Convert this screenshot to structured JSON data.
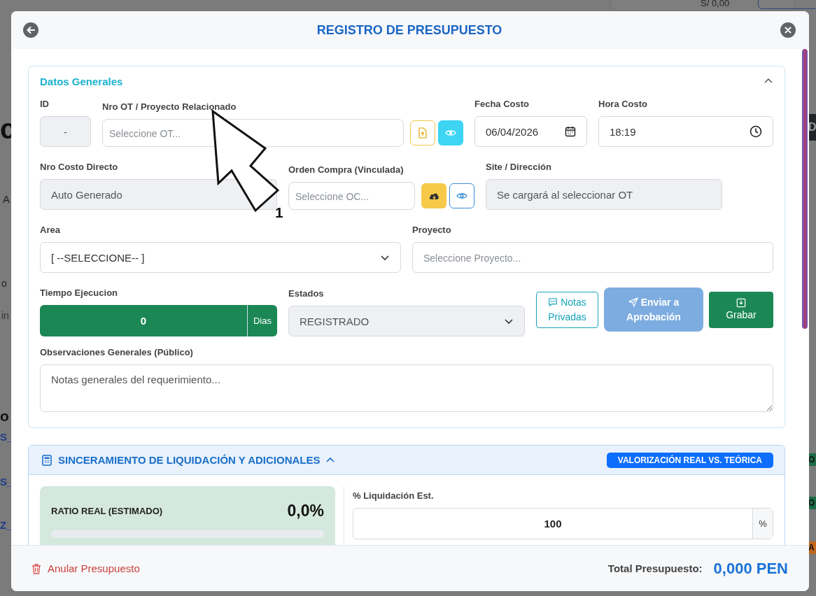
{
  "background_page": {
    "top_card_amount": "S/ 0,00",
    "title_fragment": "c",
    "tab_fragment": "A",
    "side_texts": [
      "o",
      "in"
    ],
    "section_fragment": "o",
    "link_fragments": [
      "S_",
      "S_",
      "Z_"
    ],
    "right_badges": [
      {
        "text": "D",
        "color": "#212529"
      },
      {
        "text": "O",
        "color": "#1e6b48"
      },
      {
        "text": "O",
        "color": "#1e6b48"
      },
      {
        "text": "A",
        "color": "#c0661a"
      }
    ]
  },
  "modal": {
    "title": "REGISTRO DE PRESUPUESTO",
    "general": {
      "title": "Datos Generales",
      "expanded": true,
      "rows": [
        [
          {
            "kind": "text",
            "label": "ID",
            "value": "-",
            "disabled": true,
            "centered": true
          },
          {
            "kind": "lookup",
            "label": "Nro OT / Proyecto Relacionado",
            "placeholder": "Seleccione OT...",
            "icons": [
              {
                "kind": "file-outline"
              },
              {
                "kind": "eye-solid"
              }
            ]
          },
          {
            "kind": "date",
            "label": "Fecha Costo",
            "value": "06/04/2026"
          },
          {
            "kind": "time",
            "label": "Hora Costo",
            "value": "18:19"
          }
        ],
        [
          {
            "kind": "text",
            "label": "Nro Costo Directo",
            "value": "Auto Generado",
            "disabled": true
          },
          {
            "kind": "lookup",
            "label": "Orden Compra (Vinculada)",
            "placeholder": "Seleccione OC...",
            "icons": [
              {
                "kind": "cloud-solid"
              },
              {
                "kind": "eye-outline"
              }
            ]
          },
          {
            "kind": "text",
            "label": "Site / Dirección",
            "value": "Se cargará al seleccionar OT",
            "disabled": true
          }
        ],
        [
          {
            "kind": "select",
            "label": "Area",
            "value": "[ --SELECCIONE-- ]",
            "disabled": false
          },
          {
            "kind": "text",
            "label": "Proyecto",
            "placeholder": "Seleccione Proyecto...",
            "disabled": false
          }
        ],
        [
          {
            "kind": "addon",
            "label": "Tiempo Ejecucion",
            "value": "0",
            "addon": "Dias"
          },
          {
            "kind": "select",
            "label": "Estados",
            "value": "REGISTRADO",
            "disabled": true
          },
          {
            "kind": "buttons",
            "buttons": [
              {
                "kind": "notes",
                "label": "Notas Privadas",
                "disabled": false
              },
              {
                "kind": "send",
                "label": "Enviar a Aprobación",
                "disabled": true
              },
              {
                "kind": "save",
                "label": "Grabar",
                "disabled": false
              }
            ]
          }
        ],
        [
          {
            "kind": "textarea",
            "label": "Observaciones Generales (Público)",
            "placeholder": "Notas generales del requerimiento..."
          }
        ]
      ]
    },
    "liquidation": {
      "title": "SINCERAMIENTO DE LIQUIDACIÓN Y ADICIONALES",
      "expanded": true,
      "badge": "VALORIZACIÓN REAL VS. TEÓRICA",
      "ratio_label": "RATIO REAL (ESTIMADO)",
      "ratio_value": "0,0%",
      "level": 0,
      "percent_label": "% Liquidación Est.",
      "percent_value": "100",
      "percent_addon": "%"
    },
    "footer": {
      "cancel": "Anular Presupuesto",
      "total_label": "Total Presupuesto:",
      "total_value": "0,000 PEN"
    }
  },
  "annotation": {
    "number": "1"
  }
}
